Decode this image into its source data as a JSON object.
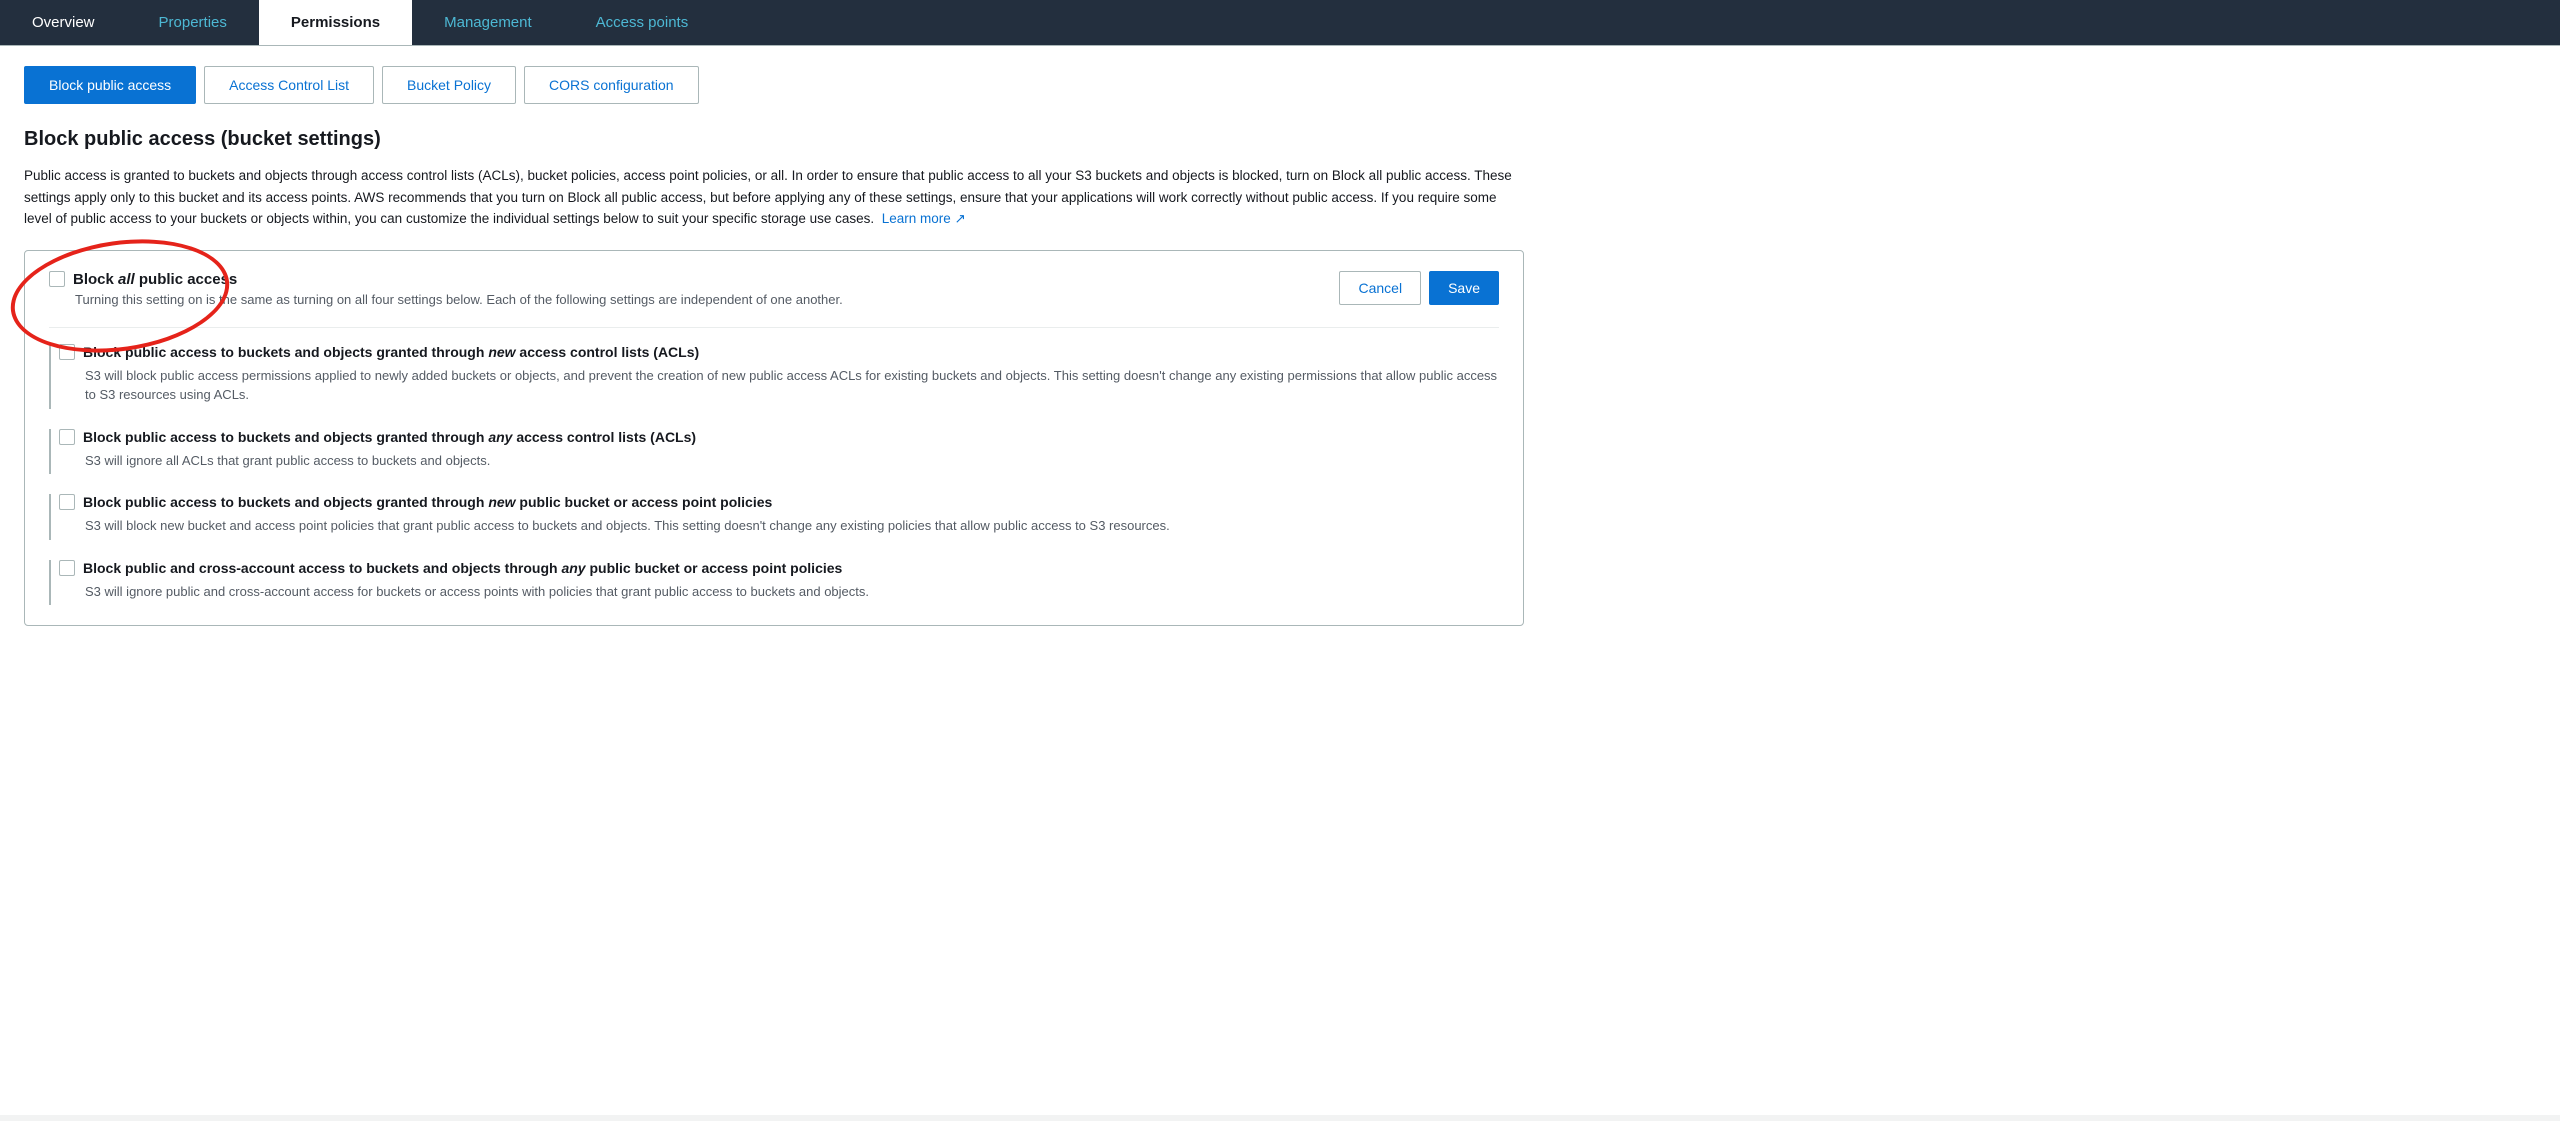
{
  "topNav": {
    "tabs": [
      {
        "id": "overview",
        "label": "Overview",
        "active": false
      },
      {
        "id": "properties",
        "label": "Properties",
        "active": false
      },
      {
        "id": "permissions",
        "label": "Permissions",
        "active": true
      },
      {
        "id": "management",
        "label": "Management",
        "active": false
      },
      {
        "id": "access-points",
        "label": "Access points",
        "active": false
      }
    ]
  },
  "subTabs": {
    "tabs": [
      {
        "id": "block-public-access",
        "label": "Block public access",
        "active": true
      },
      {
        "id": "acl",
        "label": "Access Control List",
        "active": false
      },
      {
        "id": "bucket-policy",
        "label": "Bucket Policy",
        "active": false
      },
      {
        "id": "cors",
        "label": "CORS configuration",
        "active": false
      }
    ]
  },
  "pageTitle": "Block public access (bucket settings)",
  "description": "Public access is granted to buckets and objects through access control lists (ACLs), bucket policies, access point policies, or all. In order to ensure that public access to all your S3 buckets and objects is blocked, turn on Block all public access. These settings apply only to this bucket and its access points. AWS recommends that you turn on Block all public access, but before applying any of these settings, ensure that your applications will work correctly without public access. If you require some level of public access to your buckets or objects within, you can customize the individual settings below to suit your specific storage use cases.",
  "learnMoreLink": "Learn more",
  "blockAllSection": {
    "title": "Block ",
    "titleItalic": "all",
    "titleSuffix": " public access",
    "description": "Turning this setting on is the same as turning on all four settings below. Each of the following settings are independent of one another.",
    "checked": false
  },
  "buttons": {
    "cancel": "Cancel",
    "save": "Save"
  },
  "settings": [
    {
      "id": "setting1",
      "titlePrefix": "Block public access to buckets and objects granted through ",
      "titleItalic": "new",
      "titleSuffix": " access control lists (ACLs)",
      "description": "S3 will block public access permissions applied to newly added buckets or objects, and prevent the creation of new public access ACLs for existing buckets and objects. This setting doesn't change any existing permissions that allow public access to S3 resources using ACLs.",
      "checked": false
    },
    {
      "id": "setting2",
      "titlePrefix": "Block public access to buckets and objects granted through ",
      "titleItalic": "any",
      "titleSuffix": " access control lists (ACLs)",
      "description": "S3 will ignore all ACLs that grant public access to buckets and objects.",
      "checked": false
    },
    {
      "id": "setting3",
      "titlePrefix": "Block public access to buckets and objects granted through ",
      "titleItalic": "new",
      "titleSuffix": " public bucket or access point policies",
      "description": "S3 will block new bucket and access point policies that grant public access to buckets and objects. This setting doesn't change any existing policies that allow public access to S3 resources.",
      "checked": false
    },
    {
      "id": "setting4",
      "titlePrefix": "Block public and cross-account access to buckets and objects through ",
      "titleItalic": "any",
      "titleSuffix": " public bucket or access point policies",
      "description": "S3 will ignore public and cross-account access for buckets or access points with policies that grant public access to buckets and objects.",
      "checked": false
    }
  ]
}
